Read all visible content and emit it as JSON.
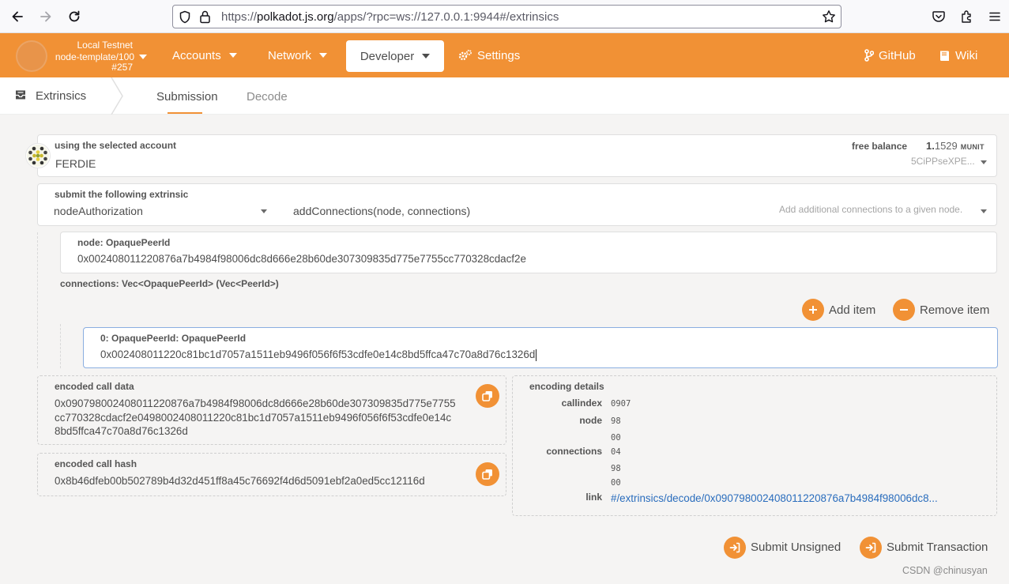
{
  "browser": {
    "url_prefix": "https://",
    "url_host": "polkadot.js.org",
    "url_rest": "/apps/?rpc=ws://127.0.0.1:9944#/extrinsics"
  },
  "header": {
    "chain_name": "Local Testnet",
    "chain_runtime": "node-template/100",
    "chain_block": "#257",
    "nav": {
      "accounts": "Accounts",
      "network": "Network",
      "developer": "Developer",
      "settings": "Settings",
      "github": "GitHub",
      "wiki": "Wiki"
    }
  },
  "subheader": {
    "title": "Extrinsics",
    "tabs": [
      "Submission",
      "Decode"
    ]
  },
  "account": {
    "label": "using the selected account",
    "name": "FERDIE",
    "balance_label": "free balance",
    "balance_int": "1.",
    "balance_frac": "1529",
    "balance_unit": "MUNIT",
    "address_short": "5CiPPseXPE..."
  },
  "extrinsic": {
    "label": "submit the following extrinsic",
    "pallet": "nodeAuthorization",
    "call": "addConnections(node, connections)",
    "description": "Add additional connections to a given node."
  },
  "params": {
    "node_label": "node: OpaquePeerId",
    "node_value": "0x002408011220876a7b4984f98006dc8d666e28b60de307309835d775e7755cc770328cdacf2e",
    "connections_label": "connections: Vec<OpaquePeerId> (Vec<PeerId>)",
    "add_item": "Add item",
    "remove_item": "Remove item",
    "item0_label": "0: OpaquePeerId: OpaquePeerId",
    "item0_value": "0x002408011220c81bc1d7057a1511eb9496f056f6f53cdfe0e14c8bd5ffca47c70a8d76c1326d"
  },
  "encoded": {
    "call_data_label": "encoded call data",
    "call_data_line1": "0x0907980024080112208 76a7b4984f98006dc8d666e28b60de307309835d775e7755",
    "call_data_l1": "0x090798002408011220876a7b4984f98006dc8d666e28b60de307309835d775e7755",
    "call_data_l2": "cc770328cdacf2e0498002408011220c81bc1d7057a1511eb9496f056f6f53cdfe0e14c",
    "call_data_l3": "8bd5ffca47c70a8d76c1326d",
    "call_hash_label": "encoded call hash",
    "call_hash": "0x8b46dfeb00b502789b4d32d451ff8a45c76692f4d6d5091ebf2a0ed5cc12116d"
  },
  "details": {
    "title": "encoding details",
    "callindex_key": "callindex",
    "callindex_val": "0907",
    "node_key": "node",
    "node_val": "98",
    "node_val2": "00",
    "connections_key": "connections",
    "connections_val": "04",
    "connections_val2": "98",
    "connections_val3": "00",
    "link_key": "link",
    "link_val": "#/extrinsics/decode/0x090798002408011220876a7b4984f98006dc8..."
  },
  "actions": {
    "submit_unsigned": "Submit Unsigned",
    "submit_transaction": "Submit Transaction"
  },
  "watermark": "CSDN @chinusyan",
  "colors": {
    "accent": "#f19135",
    "link": "#2a6dbd"
  }
}
